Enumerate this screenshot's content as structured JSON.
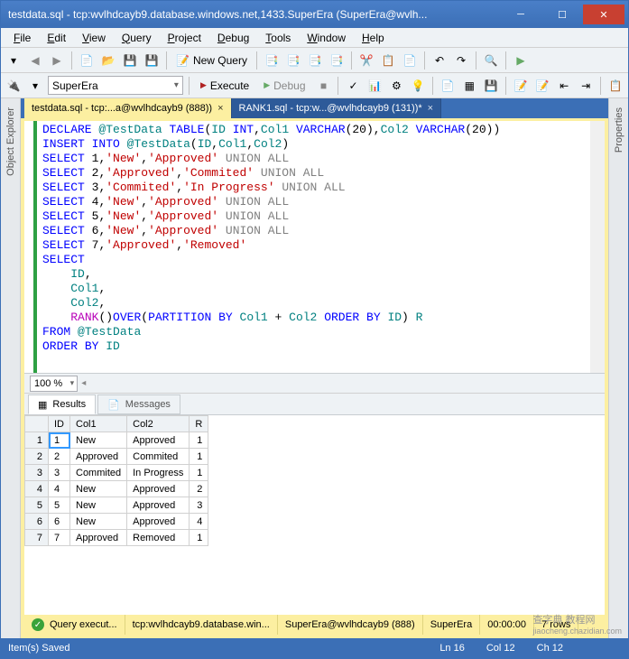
{
  "window": {
    "title": "testdata.sql - tcp:wvlhdcayb9.database.windows.net,1433.SuperEra (SuperEra@wvlh..."
  },
  "menu": [
    "File",
    "Edit",
    "View",
    "Query",
    "Project",
    "Debug",
    "Tools",
    "Window",
    "Help"
  ],
  "toolbar": {
    "new_query": "New Query"
  },
  "toolbar2": {
    "db": "SuperEra",
    "execute": "Execute",
    "debug": "Debug"
  },
  "side_tabs": {
    "left": "Object Explorer",
    "right": "Properties"
  },
  "doc_tabs": [
    {
      "label": "testdata.sql - tcp:...a@wvlhdcayb9 (888))",
      "active": true
    },
    {
      "label": "RANK1.sql - tcp:w...@wvlhdcayb9 (131))*",
      "active": false
    }
  ],
  "code_raw": "DECLARE @TestData TABLE(ID INT,Col1 VARCHAR(20),Col2 VARCHAR(20))\nINSERT INTO @TestData(ID,Col1,Col2)\nSELECT 1,'New','Approved' UNION ALL\nSELECT 2,'Approved','Commited' UNION ALL\nSELECT 3,'Commited','In Progress' UNION ALL\nSELECT 4,'New','Approved' UNION ALL\nSELECT 5,'New','Approved' UNION ALL\nSELECT 6,'New','Approved' UNION ALL\nSELECT 7,'Approved','Removed'\nSELECT\n    ID,\n    Col1,\n    Col2,\n    RANK()OVER(PARTITION BY Col1 + Col2 ORDER BY ID) R\nFROM @TestData\nORDER BY ID",
  "zoom": {
    "value": "100 %"
  },
  "results_tabs": {
    "results": "Results",
    "messages": "Messages"
  },
  "grid": {
    "columns": [
      "",
      "ID",
      "Col1",
      "Col2",
      "R"
    ],
    "rows": [
      {
        "n": "1",
        "ID": "1",
        "Col1": "New",
        "Col2": "Approved",
        "R": "1"
      },
      {
        "n": "2",
        "ID": "2",
        "Col1": "Approved",
        "Col2": "Commited",
        "R": "1"
      },
      {
        "n": "3",
        "ID": "3",
        "Col1": "Commited",
        "Col2": "In Progress",
        "R": "1"
      },
      {
        "n": "4",
        "ID": "4",
        "Col1": "New",
        "Col2": "Approved",
        "R": "2"
      },
      {
        "n": "5",
        "ID": "5",
        "Col1": "New",
        "Col2": "Approved",
        "R": "3"
      },
      {
        "n": "6",
        "ID": "6",
        "Col1": "New",
        "Col2": "Approved",
        "R": "4"
      },
      {
        "n": "7",
        "ID": "7",
        "Col1": "Approved",
        "Col2": "Removed",
        "R": "1"
      }
    ]
  },
  "query_status": {
    "status": "Query execut...",
    "server": "tcp:wvlhdcayb9.database.win...",
    "login": "SuperEra@wvlhdcayb9 (888)",
    "db": "SuperEra",
    "elapsed": "00:00:00",
    "rows": "7 rows"
  },
  "status_bar": {
    "left": "Item(s) Saved",
    "ln": "Ln 16",
    "col": "Col 12",
    "ch": "Ch 12"
  },
  "watermark": {
    "line1": "查字典 教程网",
    "line2": "jiaocheng.chazidian.com"
  }
}
